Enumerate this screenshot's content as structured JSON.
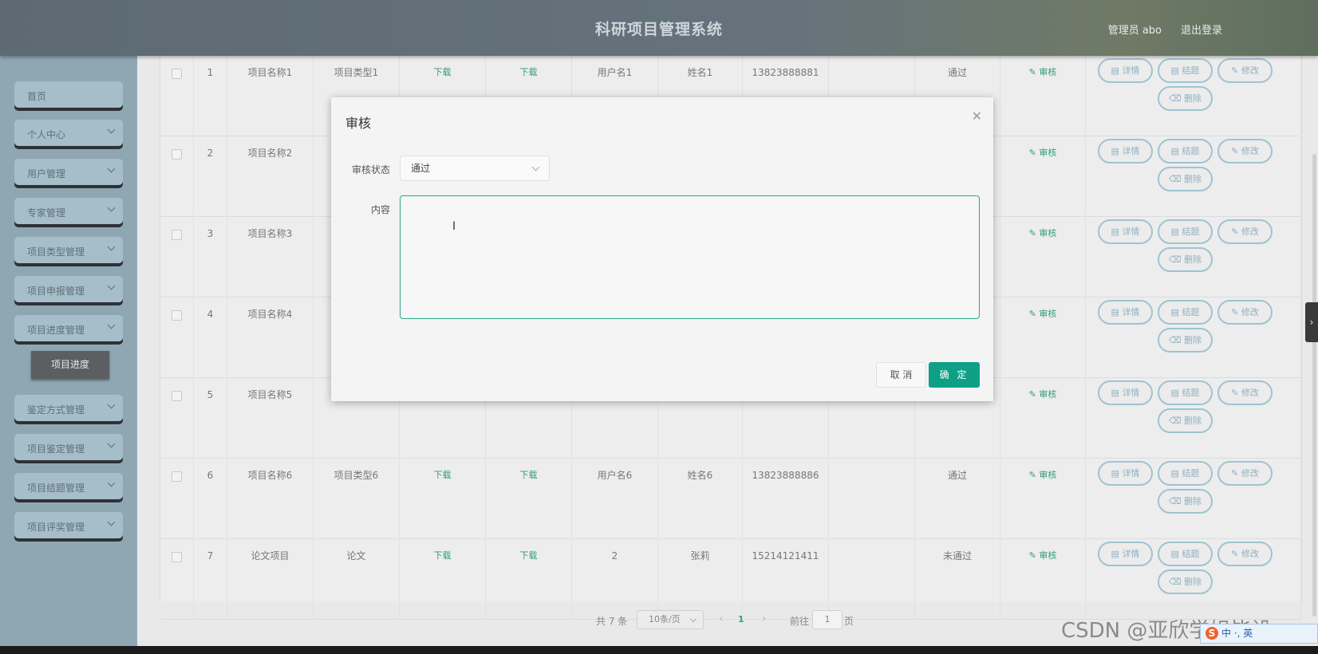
{
  "header": {
    "title": "科研项目管理系统",
    "user": "管理员 abo",
    "logout": "退出登录"
  },
  "sidebar": {
    "items": [
      {
        "label": "首页"
      },
      {
        "label": "个人中心"
      },
      {
        "label": "用户管理"
      },
      {
        "label": "专家管理"
      },
      {
        "label": "项目类型管理"
      },
      {
        "label": "项目申报管理"
      },
      {
        "label": "项目进度管理"
      },
      {
        "label": "鉴定方式管理"
      },
      {
        "label": "项目鉴定管理"
      },
      {
        "label": "项目结题管理"
      },
      {
        "label": "项目评奖管理"
      }
    ],
    "submenu_label": "项目进度"
  },
  "table": {
    "rows": [
      {
        "index": "1",
        "name": "项目名称1",
        "type": "项目类型1",
        "file1": "下载",
        "file2": "下载",
        "user": "用户名1",
        "realname": "姓名1",
        "phone": "13823888881",
        "status": "通过",
        "audit": "审核"
      },
      {
        "index": "2",
        "name": "项目名称2",
        "type": "",
        "file1": "",
        "file2": "",
        "user": "",
        "realname": "",
        "phone": "",
        "status": "",
        "audit": "审核"
      },
      {
        "index": "3",
        "name": "项目名称3",
        "type": "",
        "file1": "",
        "file2": "",
        "user": "",
        "realname": "",
        "phone": "",
        "status": "",
        "audit": "审核"
      },
      {
        "index": "4",
        "name": "项目名称4",
        "type": "",
        "file1": "",
        "file2": "",
        "user": "",
        "realname": "",
        "phone": "",
        "status": "",
        "audit": "审核"
      },
      {
        "index": "5",
        "name": "项目名称5",
        "type": "",
        "file1": "",
        "file2": "",
        "user": "",
        "realname": "",
        "phone": "",
        "status": "",
        "audit": "审核"
      },
      {
        "index": "6",
        "name": "项目名称6",
        "type": "项目类型6",
        "file1": "下载",
        "file2": "下载",
        "user": "用户名6",
        "realname": "姓名6",
        "phone": "13823888886",
        "status": "通过",
        "audit": "审核"
      },
      {
        "index": "7",
        "name": "论文项目",
        "type": "论文",
        "file1": "下载",
        "file2": "下载",
        "user": "2",
        "realname": "张莉",
        "phone": "15214121411",
        "status": "未通过",
        "audit": "审核"
      }
    ],
    "actions": {
      "detail": "详情",
      "finish": "结题",
      "edit": "修改",
      "delete": "删除"
    }
  },
  "pagination": {
    "total": "共 7 条",
    "page_size": "10条/页",
    "current_page": "1",
    "goto_label": "前往",
    "goto_value": "1",
    "page_suffix": "页"
  },
  "dialog": {
    "title": "审核",
    "status_label": "审核状态",
    "status_value": "通过",
    "content_label": "内容",
    "content_value": "",
    "cancel": "取 消",
    "confirm": "确 定"
  },
  "watermark": "CSDN @亚欣学姐毕设",
  "ime": "中 ·, 英"
}
